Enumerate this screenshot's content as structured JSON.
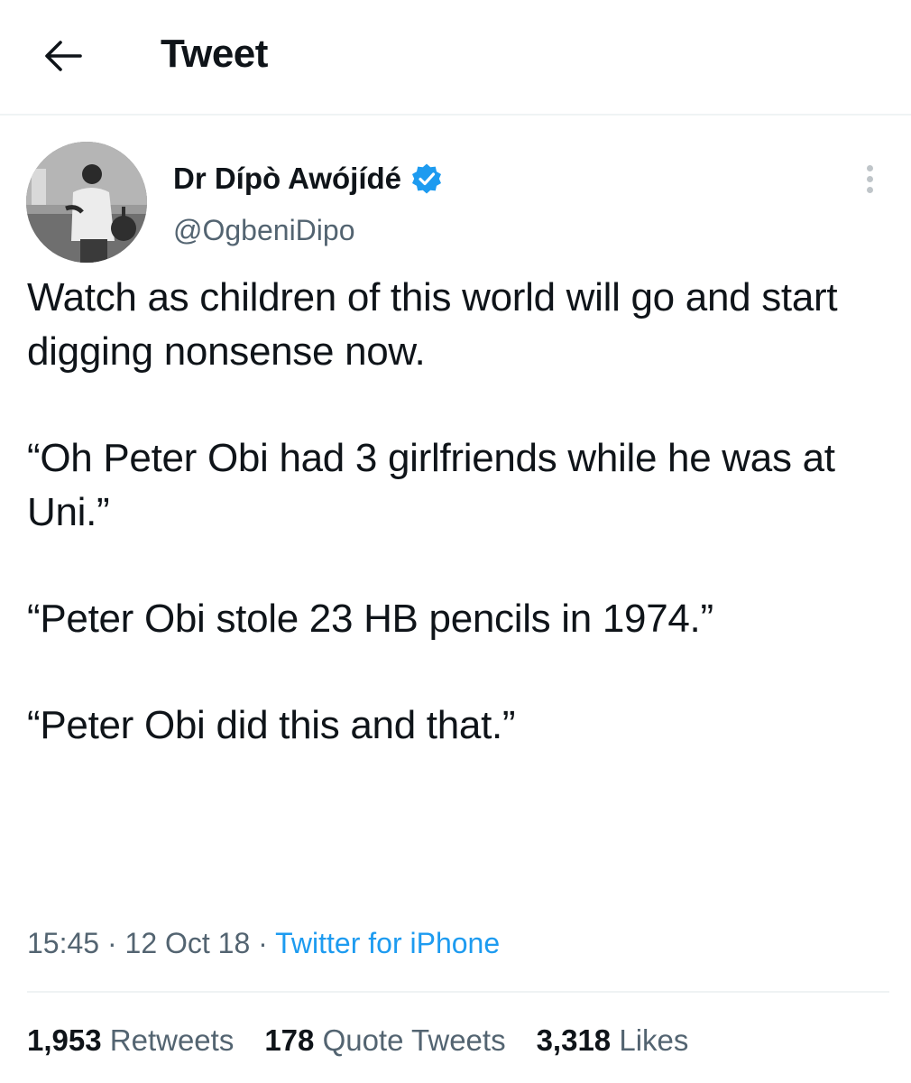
{
  "header": {
    "title": "Tweet",
    "back_icon": "arrow-left-icon"
  },
  "tweet": {
    "author": {
      "name": "Dr Dípò Awójídé",
      "handle": "@OgbeniDipo",
      "verified": true,
      "verified_color": "#1d9bf0"
    },
    "paragraphs": [
      "Watch as children of this world will go and start digging nonsense now.",
      "“Oh Peter Obi had 3 girlfriends while he was at Uni.”",
      "“Peter Obi stole 23 HB pencils in 1974.”",
      "“Peter Obi did this and that.”"
    ],
    "time": "15:45",
    "date": "12 Oct 18",
    "separator": "·",
    "source": "Twitter for iPhone"
  },
  "stats": {
    "retweets": {
      "count": "1,953",
      "label": "Retweets"
    },
    "quotes": {
      "count": "178",
      "label": "Quote Tweets"
    },
    "likes": {
      "count": "3,318",
      "label": "Likes"
    }
  },
  "colors": {
    "accent": "#1d9bf0",
    "text": "#0f1419",
    "secondary": "#536471"
  }
}
